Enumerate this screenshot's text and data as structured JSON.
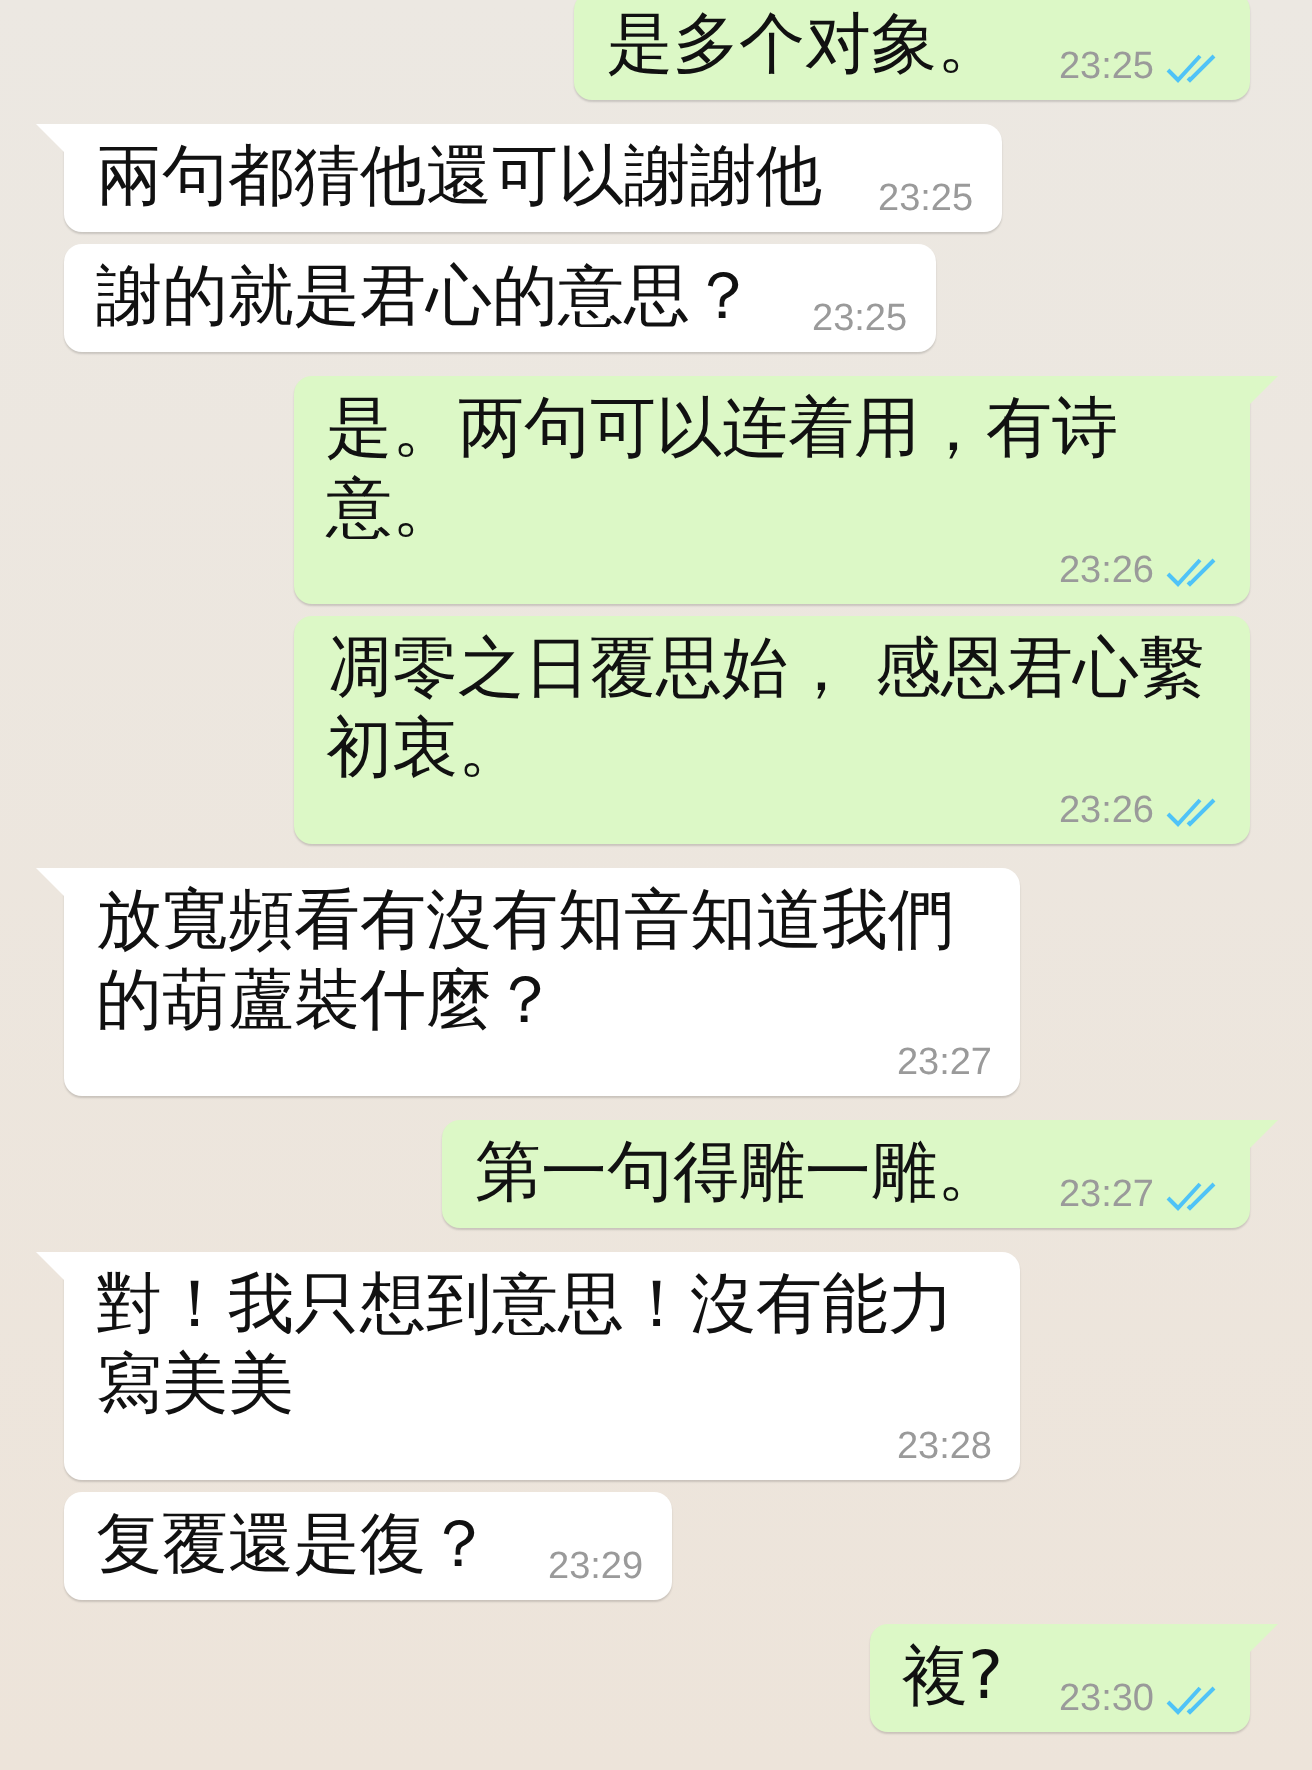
{
  "messages": [
    {
      "kind": "out",
      "tail": false,
      "text": "是多个对象。",
      "time": "23:25",
      "read": true
    },
    {
      "kind": "in",
      "tail": true,
      "text": "兩句都猜他還可以謝謝他",
      "time": "23:25"
    },
    {
      "kind": "in",
      "tail": false,
      "text": "謝的就是君心的意思？",
      "time": "23:25"
    },
    {
      "kind": "out",
      "tail": true,
      "text": "是。两句可以连着用，有诗意。",
      "time": "23:26",
      "read": true
    },
    {
      "kind": "out",
      "tail": false,
      "text": "凋零之日覆思始， 感恩君心繫初衷。",
      "time": "23:26",
      "read": true
    },
    {
      "kind": "in",
      "tail": true,
      "text": "放寬頻看有沒有知音知道我們的葫蘆裝什麼？",
      "time": "23:27"
    },
    {
      "kind": "out",
      "tail": true,
      "text": "第一句得雕一雕。",
      "time": "23:27",
      "read": true
    },
    {
      "kind": "in",
      "tail": true,
      "text": "對！我只想到意思！沒有能力寫美美",
      "time": "23:28"
    },
    {
      "kind": "in",
      "tail": false,
      "text": "复覆還是復？",
      "time": "23:29"
    },
    {
      "kind": "out",
      "tail": true,
      "text": "複?",
      "time": "23:30",
      "read": true
    }
  ]
}
